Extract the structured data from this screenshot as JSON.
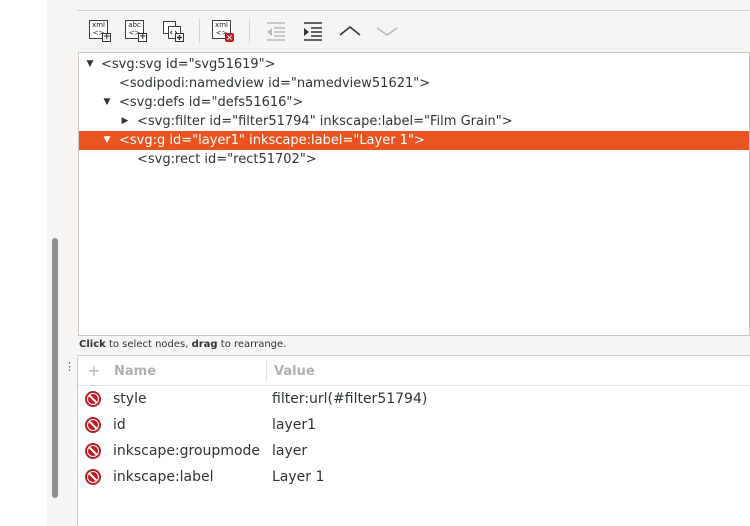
{
  "toolbar": {
    "new_element_icon_text": [
      "xml",
      "<>"
    ],
    "new_text_icon_text": [
      "abc",
      "<>"
    ],
    "delete_icon_text": [
      "xml",
      "<>"
    ]
  },
  "tree": {
    "nodes": [
      "<svg:svg id=\"svg51619\">",
      "<sodipodi:namedview id=\"namedview51621\">",
      "<svg:defs id=\"defs51616\">",
      "<svg:filter id=\"filter51794\" inkscape:label=\"Film Grain\">",
      "<svg:g id=\"layer1\" inkscape:label=\"Layer 1\">",
      "<svg:rect id=\"rect51702\">"
    ],
    "selected_index": 4
  },
  "hint": {
    "click": "Click",
    "click_rest": " to select nodes, ",
    "drag": "drag",
    "drag_rest": " to rearrange."
  },
  "attributes": {
    "header_name": "Name",
    "header_value": "Value",
    "rows": [
      {
        "name": "style",
        "value": "filter:url(#filter51794)"
      },
      {
        "name": "id",
        "value": "layer1"
      },
      {
        "name": "inkscape:groupmode",
        "value": "layer"
      },
      {
        "name": "inkscape:label",
        "value": "Layer 1"
      }
    ]
  },
  "colors": {
    "selection": "#e95420",
    "delete": "#c01c28"
  }
}
